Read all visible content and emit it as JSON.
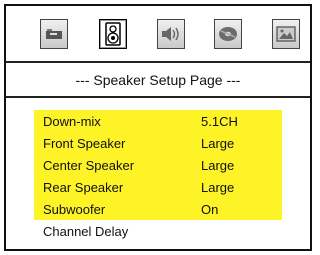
{
  "toolbar": {
    "icons": [
      {
        "name": "wrench-icon",
        "active": false
      },
      {
        "name": "speaker-icon",
        "active": true
      },
      {
        "name": "sound-wave-icon",
        "active": false
      },
      {
        "name": "disc-icon",
        "active": false
      },
      {
        "name": "picture-icon",
        "active": false
      }
    ]
  },
  "page_title": "--- Speaker Setup Page ---",
  "menu": {
    "items": [
      {
        "label": "Down-mix",
        "value": "5.1CH",
        "highlighted": true
      },
      {
        "label": "Front Speaker",
        "value": "Large",
        "highlighted": true
      },
      {
        "label": "Center Speaker",
        "value": "Large",
        "highlighted": true
      },
      {
        "label": "Rear Speaker",
        "value": "Large",
        "highlighted": true
      },
      {
        "label": "Subwoofer",
        "value": "On",
        "highlighted": true
      },
      {
        "label": "Channel Delay",
        "value": "",
        "highlighted": false
      }
    ]
  },
  "colors": {
    "highlight": "#fdf326",
    "border": "#111111",
    "background": "#ffffff"
  }
}
